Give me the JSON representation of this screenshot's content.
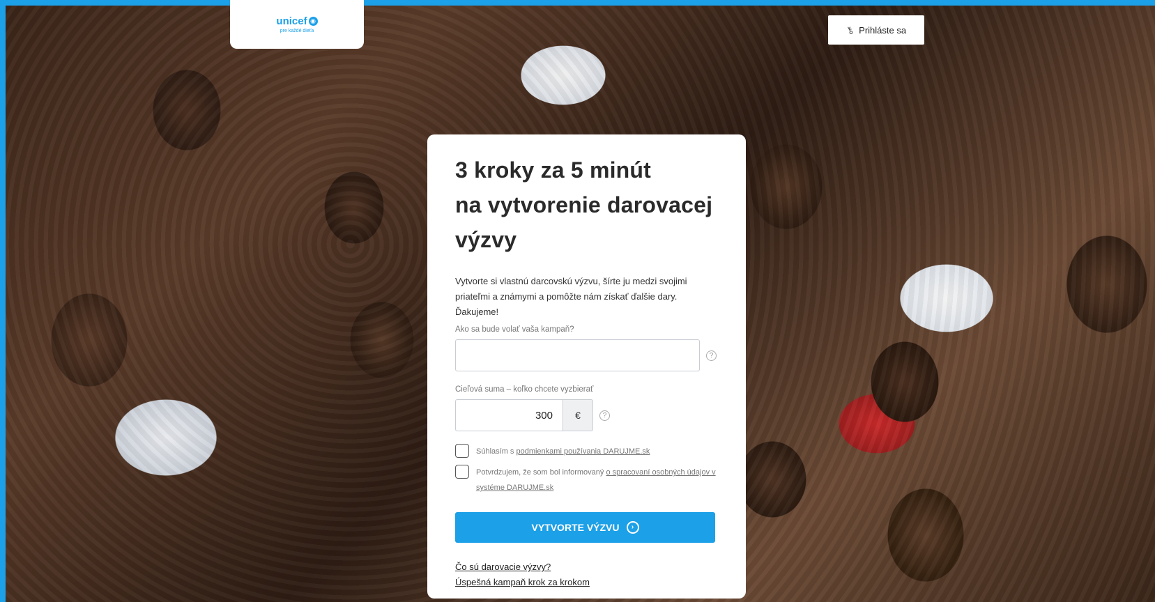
{
  "brand": {
    "logo_text": "unicef",
    "tagline": "pre každé dieťa"
  },
  "header": {
    "login_label": "Prihláste sa"
  },
  "form": {
    "title_line1": "3 kroky za 5 minút",
    "title_line2": "na vytvorenie darovacej",
    "title_line3": "výzvy",
    "intro": "Vytvorte si vlastnú darcovskú výzvu, šírte ju medzi svojimi priateľmi a známymi a pomôžte nám získať ďalšie dary. Ďakujeme!",
    "campaign_label": "Ako sa bude volať vaša kampaň?",
    "campaign_value": "",
    "amount_label": "Cieľová suma – koľko chcete vyzbierať",
    "amount_value": "300",
    "currency": "€",
    "help_symbol": "?",
    "terms_prefix": "Súhlasím s ",
    "terms_link": "podmienkami používania DARUJME.sk",
    "privacy_prefix": "Potvrdzujem, že som bol informovaný ",
    "privacy_link": "o spracovaní osobných údajov v systéme DARUJME.sk",
    "submit_label": "VYTVORTE VÝZVU",
    "link_what": "Čo sú darovacie výzvy?",
    "link_steps": "Úspešná kampaň krok za krokom"
  },
  "colors": {
    "accent": "#1ca0e8",
    "frame": "#1ca0e8"
  }
}
